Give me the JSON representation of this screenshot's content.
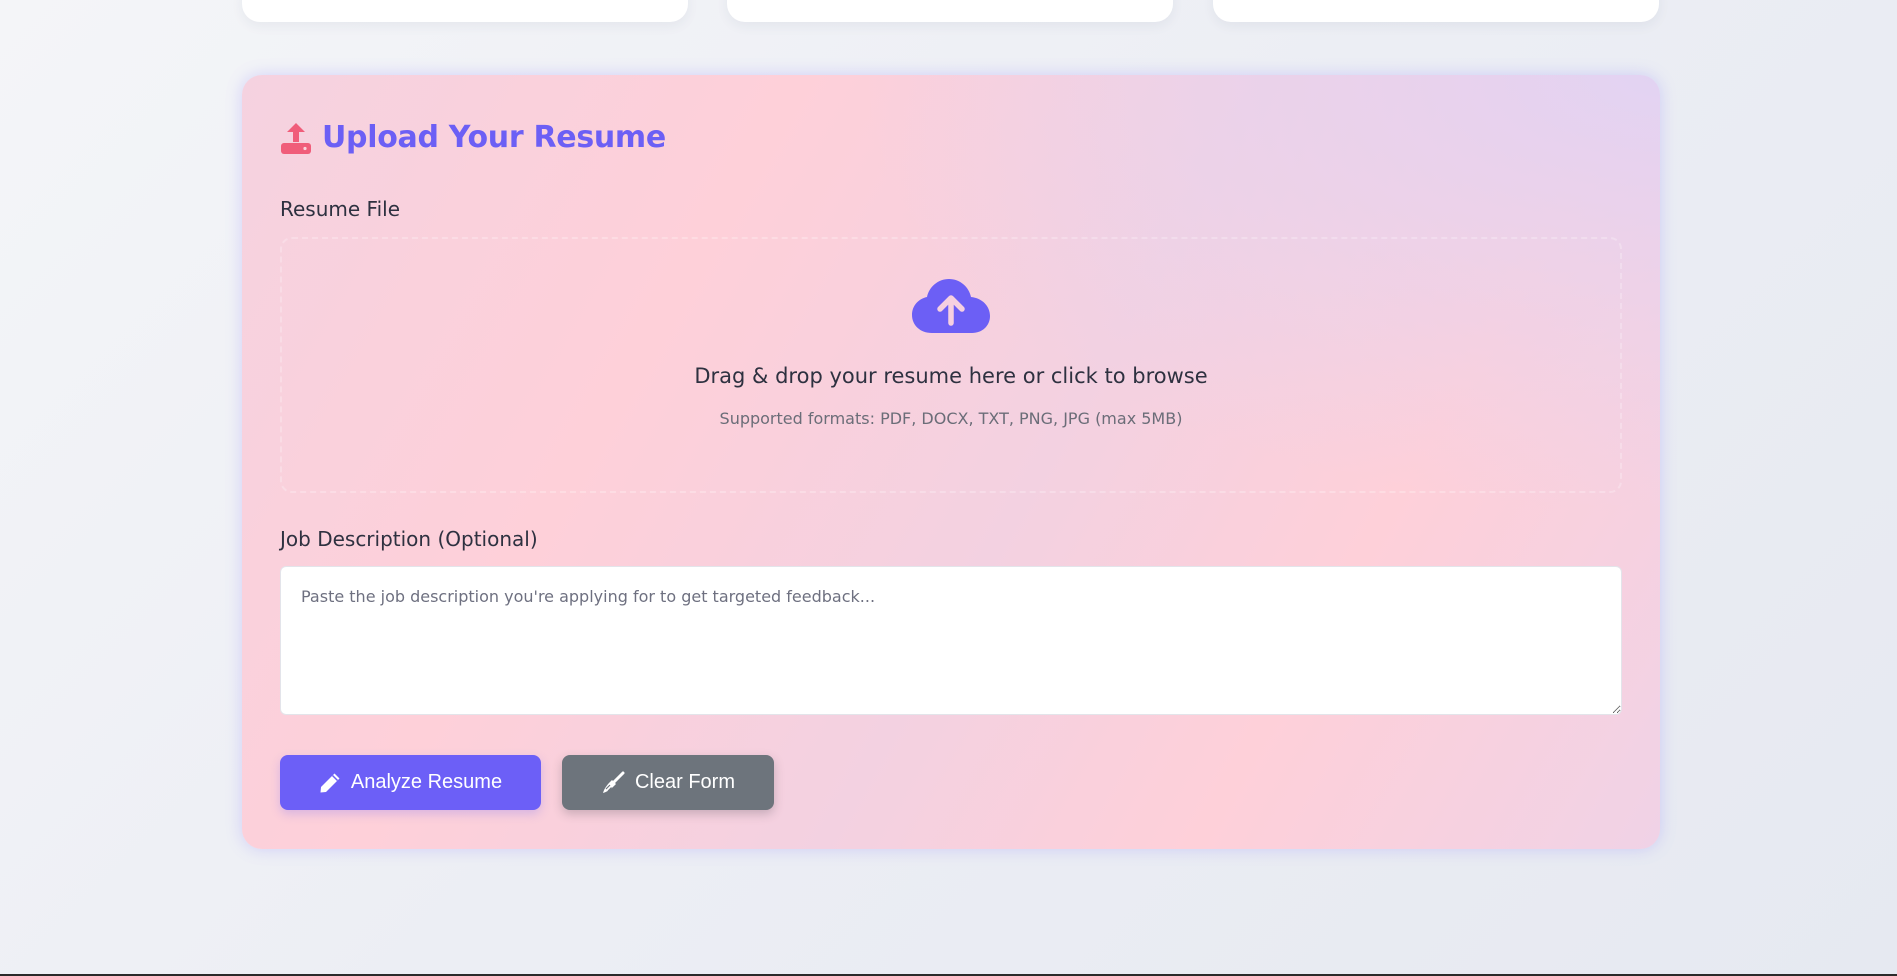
{
  "upload": {
    "title": "Upload Your Resume",
    "file_label": "Resume File",
    "drop_main": "Drag & drop your resume here or click to browse",
    "drop_sub": "Supported formats: PDF, DOCX, TXT, PNG, JPG (max 5MB)",
    "job_label": "Job Description (Optional)",
    "job_placeholder": "Paste the job description you're applying for to get targeted feedback...",
    "job_value": ""
  },
  "buttons": {
    "analyze_label": "Analyze Resume",
    "clear_label": "Clear Form"
  },
  "icons": {
    "title_icon": "upload-icon",
    "dropzone_icon": "cloud-upload-icon",
    "analyze_icon": "pencil-icon",
    "clear_icon": "broom-icon"
  },
  "colors": {
    "accent": "#6c5ff5",
    "icon_accent": "#f05d7a",
    "clear_button": "#6d747c"
  }
}
